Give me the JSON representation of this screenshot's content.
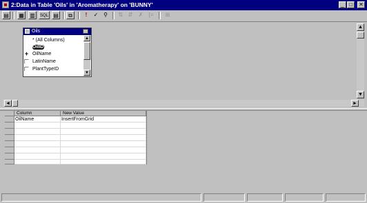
{
  "window": {
    "title": "2:Data in Table 'Oils' in 'Aromatherapy' on 'BUNNY'",
    "controls": {
      "minimize": "_",
      "maximize": "□",
      "close": "✕"
    }
  },
  "toolbar": {
    "buttons": [
      {
        "icon": "properties-icon",
        "glyph": "▤"
      },
      {
        "icon": "diagram-pane-icon",
        "glyph": "▦"
      },
      {
        "icon": "grid-pane-icon",
        "glyph": "▥"
      },
      {
        "icon": "sql-pane-icon",
        "glyph": "SQL"
      },
      {
        "icon": "results-pane-icon",
        "glyph": "▤"
      },
      {
        "icon": "change-query-type-icon",
        "glyph": "⧉"
      },
      {
        "icon": "run-icon",
        "glyph": "!"
      },
      {
        "icon": "verify-sql-icon",
        "glyph": "✓"
      },
      {
        "icon": "remove-filter-icon",
        "glyph": "⚲"
      },
      {
        "icon": "sort-ascending-icon",
        "glyph": "⇅"
      },
      {
        "icon": "sort-descending-icon",
        "glyph": "⇵"
      },
      {
        "icon": "remove-filter-2-icon",
        "glyph": "✗"
      },
      {
        "icon": "group-by-icon",
        "glyph": "{="
      },
      {
        "icon": "add-table-icon",
        "glyph": "⊞"
      }
    ]
  },
  "diagram": {
    "table": {
      "title": "Oils",
      "columns": [
        {
          "label": "* (All Columns)",
          "checked": false,
          "key": false
        },
        {
          "label": "OilID",
          "checked": false,
          "key": true
        },
        {
          "label": "OilName",
          "checked": false,
          "key": false,
          "marker": "+"
        },
        {
          "label": "LatinName",
          "checked": false,
          "key": false
        },
        {
          "label": "PlantTypeID",
          "checked": false,
          "key": false
        }
      ]
    }
  },
  "grid": {
    "headers": [
      "Column",
      "New Value"
    ],
    "rows": [
      {
        "column": "OilName",
        "value": "InsertFromGrid"
      },
      {
        "column": "",
        "value": ""
      },
      {
        "column": "",
        "value": ""
      },
      {
        "column": "",
        "value": ""
      },
      {
        "column": "",
        "value": ""
      },
      {
        "column": "",
        "value": ""
      },
      {
        "column": "",
        "value": ""
      },
      {
        "column": "",
        "value": ""
      }
    ]
  },
  "colors": {
    "title_bar": "#000080",
    "face": "#c0c0c0",
    "window": "#ffffff"
  }
}
